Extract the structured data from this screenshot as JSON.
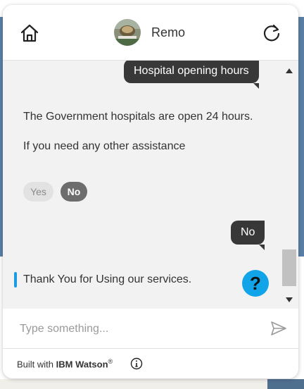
{
  "header": {
    "bot_name": "Remo",
    "home_icon": "home-icon",
    "refresh_icon": "refresh-icon"
  },
  "messages": [
    {
      "from": "user",
      "text": "Hospital opening hours"
    },
    {
      "from": "bot",
      "text": "The Government hospitals are open 24 hours."
    },
    {
      "from": "bot",
      "text": "If you need any other assistance"
    },
    {
      "from": "user",
      "text": "No"
    },
    {
      "from": "bot",
      "text": "Thank You for Using our services."
    }
  ],
  "options": {
    "yes_label": "Yes",
    "no_label": "No",
    "selected": "No"
  },
  "help_button": {
    "label": "?"
  },
  "composer": {
    "placeholder": "Type something...",
    "value": "",
    "send_icon": "send-icon"
  },
  "footer": {
    "prefix": "Built with ",
    "brand": "IBM Watson",
    "trademark": "®",
    "info_icon": "info-icon"
  },
  "colors": {
    "user_bubble": "#383838",
    "accent": "#1a9ce4",
    "help_button": "#12a4e8",
    "chip_selected": "#6d6d6d"
  }
}
